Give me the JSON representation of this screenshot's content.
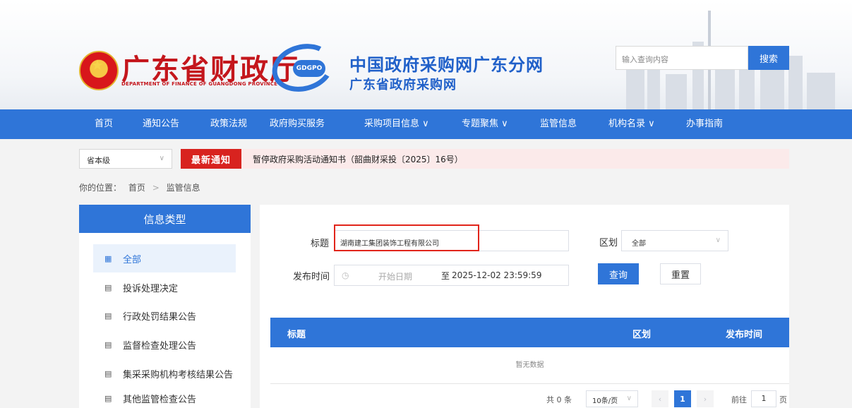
{
  "header": {
    "dept_name": "广东省财政厅",
    "dept_name_en": "DEPARTMENT OF FINANCE OF GUANGDONG PROVINCE",
    "logo_badge": "GDGPO",
    "site_title": "中国政府采购网广东分网",
    "site_subtitle": "广东省政府采购网",
    "search_placeholder": "输入查询内容",
    "search_button": "搜索"
  },
  "nav": [
    {
      "label": "首页"
    },
    {
      "label": "通知公告"
    },
    {
      "label": "政策法规"
    },
    {
      "label": "政府购买服务"
    },
    {
      "label": "采购项目信息 ∨"
    },
    {
      "label": "专题聚焦 ∨"
    },
    {
      "label": "监管信息"
    },
    {
      "label": "机构名录 ∨"
    },
    {
      "label": "办事指南"
    }
  ],
  "notice": {
    "region": "省本级",
    "tag": "最新通知",
    "text": "暂停政府采购活动通知书（韶曲财采投〔2025〕16号）"
  },
  "breadcrumb": {
    "prefix": "你的位置：",
    "home": "首页",
    "sep": ">",
    "current": "监管信息"
  },
  "sidebar": {
    "title": "信息类型",
    "items": [
      {
        "label": "全部",
        "icon": "grid-icon",
        "glyph": "▦",
        "active": true
      },
      {
        "label": "投诉处理决定",
        "icon": "document-icon",
        "glyph": "▤",
        "active": false
      },
      {
        "label": "行政处罚结果公告",
        "icon": "document-icon",
        "glyph": "▤",
        "active": false
      },
      {
        "label": "监督检查处理公告",
        "icon": "document-icon",
        "glyph": "▤",
        "active": false
      },
      {
        "label": "集采采购机构考核结果公告",
        "icon": "document-icon",
        "glyph": "▤",
        "active": false
      },
      {
        "label": "其他监管检查公告",
        "icon": "document-icon",
        "glyph": "▤",
        "active": false
      }
    ]
  },
  "filters": {
    "title_label": "标题",
    "title_value": "湖南建工集团装饰工程有限公司",
    "area_label": "区划",
    "area_value": "全部",
    "date_label": "发布时间",
    "date_start_placeholder": "开始日期",
    "date_sep": "至",
    "date_end": "2025-12-02 23:59:59",
    "query_button": "查询",
    "reset_button": "重置"
  },
  "table": {
    "columns": [
      "标题",
      "区划",
      "发布时间"
    ],
    "empty_text": "暂无数据"
  },
  "pagination": {
    "total": "共 0 条",
    "page_size": "10条/页",
    "current_page": "1",
    "goto_label": "前往",
    "goto_value": "1",
    "page_unit": "页"
  },
  "colors": {
    "primary": "#2f75d8",
    "notice_red": "#d8231f",
    "dept_red": "#c4161c",
    "highlight_red": "#e1251b"
  }
}
